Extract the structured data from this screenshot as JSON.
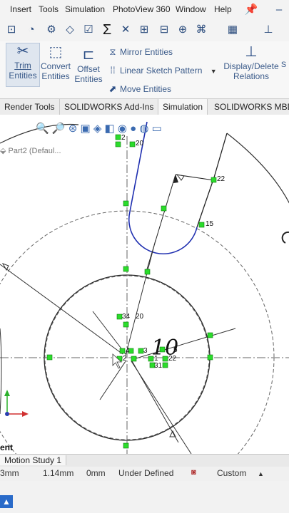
{
  "menu": [
    "Insert",
    "Tools",
    "Simulation",
    "PhotoView 360",
    "Window",
    "Help"
  ],
  "ribbon": {
    "trim": [
      "Trim",
      "Entities"
    ],
    "convert": [
      "Convert",
      "Entities"
    ],
    "offset": [
      "Offset",
      "Entities"
    ],
    "mirror": "Mirror Entities",
    "linear": "Linear Sketch Pattern",
    "move": "Move Entities",
    "display": [
      "Display/Delete",
      "Relations"
    ]
  },
  "tabs": [
    "Render Tools",
    "SOLIDWORKS Add-Ins",
    "Simulation",
    "SOLIDWORKS MBD"
  ],
  "tree": {
    "part_name": "Part2  (Defaul..."
  },
  "sketch": {
    "dimension": "10",
    "labels": {
      "l2": "2",
      "l20a": "20",
      "l22a": "22",
      "l15": "15",
      "l34": "34",
      "l20b": "20",
      "l4": "4",
      "l3": "3",
      "l5": "5",
      "l2b": "2",
      "l1": "1",
      "l22b": "22",
      "l31": "31"
    }
  },
  "bottom_tab": "Motion Study 1",
  "status": {
    "a": "3mm",
    "b": "1.14mm",
    "c": "0mm",
    "state": "Under Defined",
    "units": "Custom"
  },
  "partial": {
    "ent": "ent",
    "si": "S"
  },
  "colors": {
    "line": "#0a0a8a",
    "constraint": "#2bdc2b",
    "sketch": "#444444"
  }
}
